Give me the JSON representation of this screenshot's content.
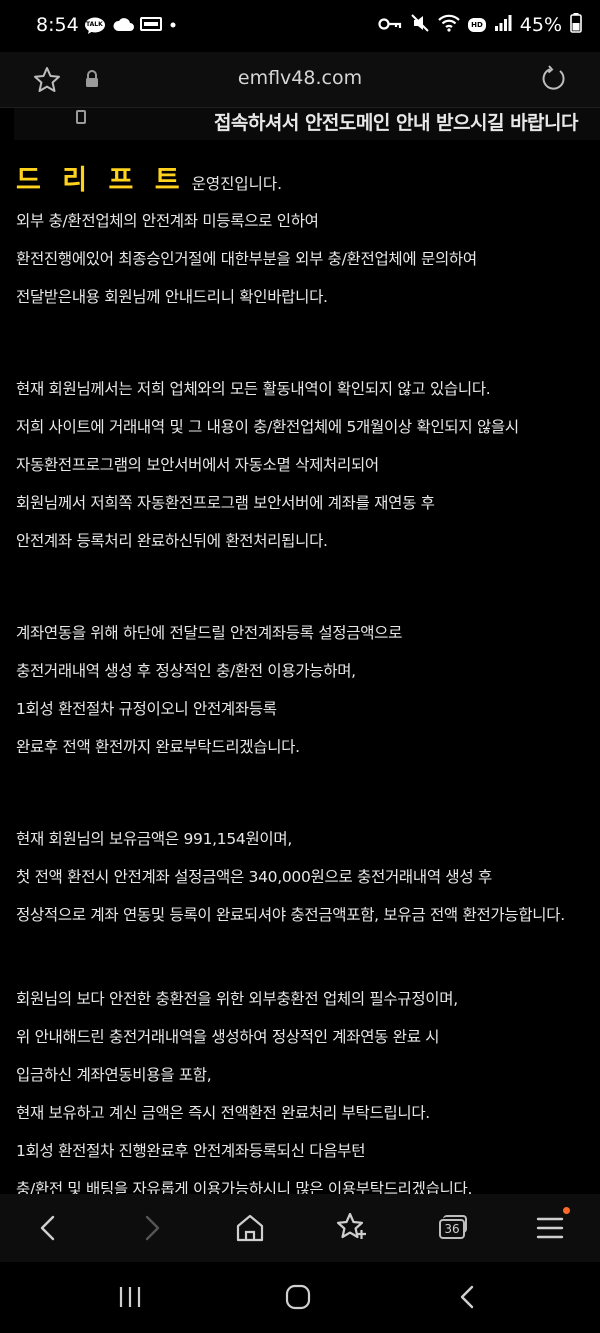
{
  "status_bar": {
    "time": "8:54",
    "left_icons": [
      "talk-icon",
      "cloud-icon",
      "notification-badge-icon",
      "dot-icon"
    ],
    "left_badge_text": "TALK",
    "right_icons": [
      "key-icon",
      "mute-icon",
      "wifi-icon",
      "hd-voice-icon",
      "signal-icon",
      "battery-icon"
    ],
    "hd_text": "HD",
    "battery": "45%"
  },
  "browser": {
    "url": "emflv48.com"
  },
  "banner": {
    "text": "접속하셔서 안전도메인 안내 받으시길 바랍니다"
  },
  "article": {
    "brand": "드 리 프 트",
    "brand_suffix": "운영진입니다.",
    "paragraphs": [
      {
        "lines": [
          "외부 충/환전업체의 안전계좌 미등록으로 인하여",
          "환전진행에있어 최종승인거절에 대한부분을 외부 충/환전업체에 문의하여",
          "전달받은내용 회원님께 안내드리니 확인바랍니다."
        ]
      },
      {
        "lines": [
          "현재 회원님께서는 저희 업체와의 모든 활동내역이 확인되지 않고 있습니다.",
          "저희 사이트에 거래내역 및 그 내용이 충/환전업체에 5개월이상 확인되지 않을시",
          "자동환전프로그램의 보안서버에서 자동소멸 삭제처리되어",
          "회원님께서 저희쪽 자동환전프로그램 보안서버에 계좌를 재연동 후",
          "안전계좌 등록처리 완료하신뒤에 환전처리됩니다."
        ]
      },
      {
        "lines": [
          "계좌연동을 위해 하단에 전달드릴 안전계좌등록 설정금액으로",
          "충전거래내역 생성 후 정상적인 충/환전 이용가능하며,",
          "1회성 환전절차 규정이오니 안전계좌등록",
          "완료후 전액 환전까지 완료부탁드리겠습니다."
        ]
      },
      {
        "lines": [
          "현재 회원님의 보유금액은 991,154원이며,",
          "첫 전액 환전시 안전계좌 설정금액은 340,000원으로 충전거래내역 생성 후",
          "정상적으로 계좌 연동및 등록이 완료되셔야 충전금액포함, 보유금 전액 환전가능합니다."
        ]
      },
      {
        "lines": [
          "회원님의 보다 안전한 충환전을 위한 외부충환전 업체의 필수규정이며,",
          "위 안내해드린 충전거래내역을 생성하여 정상적인 계좌연동 완료 시",
          "입금하신 계좌연동비용을 포함,",
          "현재 보유하고 계신 금액은 즉시 전액환전 완료처리 부탁드립니다.",
          "1회성 환전절차 진행완료후 안전계좌등록되신 다음부턴",
          "충/환전 및 배팅을 자유롭게 이용가능하시니 많은 이용부탁드리겠습니다."
        ]
      }
    ]
  },
  "toolbar": {
    "icons": [
      "back-icon",
      "forward-icon",
      "home-icon",
      "bookmark-icon",
      "tabs-icon",
      "menu-icon"
    ],
    "tab_count": "36"
  },
  "system_nav": {
    "icons": [
      "recents-icon",
      "home-button-icon",
      "back-button-icon"
    ]
  }
}
